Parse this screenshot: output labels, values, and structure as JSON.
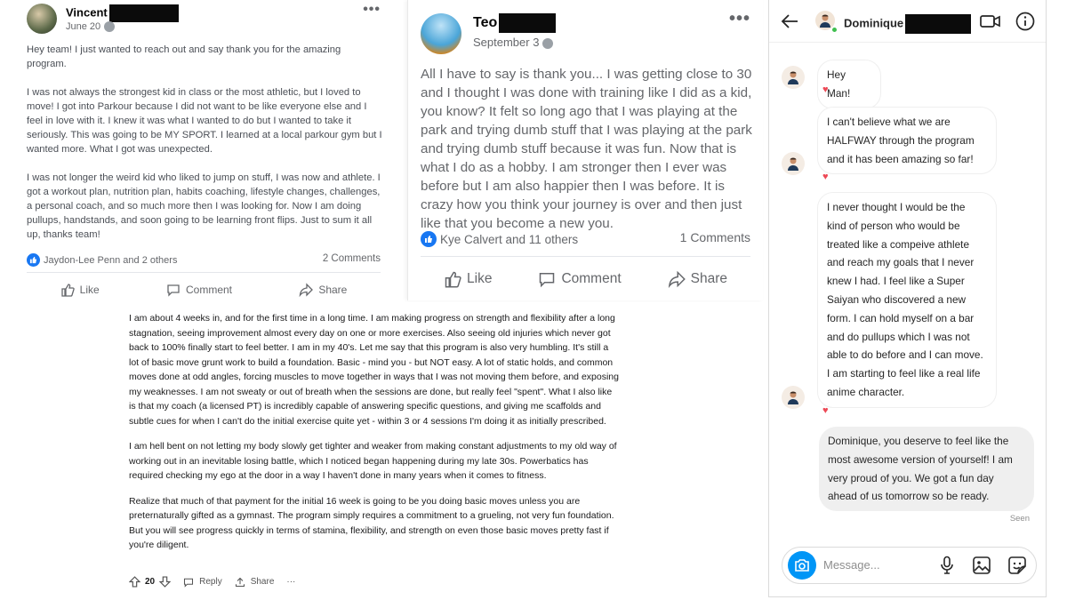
{
  "post1": {
    "author": "Vincent",
    "date": "June 20",
    "paragraphs": [
      "Hey team! I just wanted to reach out and say thank you for the amazing program.",
      "I was not always the strongest kid in class or the most athletic, but I loved to move! I got into Parkour because I did not want to be like everyone else and I feel in love with it. I knew it was what I wanted to do but I wanted to take it seriously. This was going to be MY SPORT. I learned at a local parkour gym but I wanted more. What I got was unexpected.",
      "I was not longer the weird kid who liked to jump on stuff, I was now and athlete. I got a workout plan, nutrition plan, habits coaching, lifestyle changes, challenges, a personal coach, and so much more then I was looking for. Now I am doing pullups, handstands, and soon going to be learning front flips. Just to sum it all up, thanks team!"
    ],
    "reactions": "Jaydon-Lee Penn and 2 others",
    "comments": "2 Comments",
    "actions": {
      "like": "Like",
      "comment": "Comment",
      "share": "Share"
    }
  },
  "post2": {
    "author": "Teo",
    "date": "September 3",
    "body": "All I have to say is thank you... I was getting close to 30 and I thought I was done with training like I did as a kid, you know? It felt so long ago that I was playing at the park and trying dumb stuff that I was playing at the park and trying dumb stuff because it was fun. Now that is what I do as a hobby. I am stronger then I ever was before but I am also happier then I was before. It is crazy how you think your journey is over and then just like that you become a new you.",
    "reactions": "Kye Calvert and 11 others",
    "comments": "1 Comments",
    "actions": {
      "like": "Like",
      "comment": "Comment",
      "share": "Share"
    }
  },
  "reddit": {
    "paragraphs": [
      "I am about 4 weeks in, and for the first time in a long time. I am making progress on strength and flexibility after a long stagnation, seeing improvement almost every day on one or more exercises. Also seeing old injuries which never got back to 100% finally start to feel better. I am in my 40's. Let me say that this program is also very humbling. It's still a lot of basic move grunt work to build a foundation. Basic - mind you - but NOT easy. A lot of static holds, and common moves done at odd angles, forcing muscles to move together in ways that I was not moving them before, and exposing my weaknesses. I am not sweaty or out of breath when the sessions are done, but really feel \"spent\". What I also like is that my coach (a licensed PT) is incredibly capable of answering specific questions, and giving me scaffolds and subtle cues for when I can't do the initial exercise quite yet - within 3 or 4 sessions I'm doing it as initially prescribed.",
      "I am hell bent on not letting my body slowly get tighter and weaker from making constant adjustments to my old way of working out in an inevitable losing battle, which I noticed began happening during my late 30s. Powerbatics has required checking my ego at the door in a way I haven't done in many years when it comes to fitness.",
      "Realize that much of that payment for the initial 16 week is going to be you doing basic moves unless you are preternaturally gifted as a gymnast. The program simply requires a commitment to a grueling, not very fun foundation. But you will see progress quickly in terms of stamina, flexibility, and strength on even those basic moves pretty fast if you're diligent."
    ],
    "votes": "20",
    "reply": "Reply",
    "share": "Share",
    "more": "···"
  },
  "dm": {
    "contact": "Dominique",
    "messages_in": [
      "Hey Man!",
      "I can't believe what we are HALFWAY through the program and it has been amazing so far!",
      "I never thought I would be the kind of person who would be treated like a compeive athlete and reach my goals that I never knew I had. I feel like a Super Saiyan who discovered a new form. I can hold myself on a bar and do pullups which I was not able to do before and I can move. I am starting to feel like a real life anime character."
    ],
    "message_out": "Dominique, you deserve to feel like the most awesome version of yourself! I am very proud of you. We got a fun day ahead of us tomorrow so be ready.",
    "seen": "Seen",
    "placeholder": "Message..."
  },
  "colors": {
    "facebook_blue": "#1877f2",
    "instagram_blue": "#0095f6",
    "heart_red": "#ed4956"
  },
  "icons": [
    "globe-icon",
    "more-dots-icon",
    "like-thumb-icon",
    "comment-icon",
    "share-arrow-icon",
    "upvote-icon",
    "downvote-icon",
    "back-arrow-icon",
    "video-call-icon",
    "info-icon",
    "camera-icon",
    "microphone-icon",
    "image-icon",
    "sticker-icon",
    "heart-icon"
  ]
}
